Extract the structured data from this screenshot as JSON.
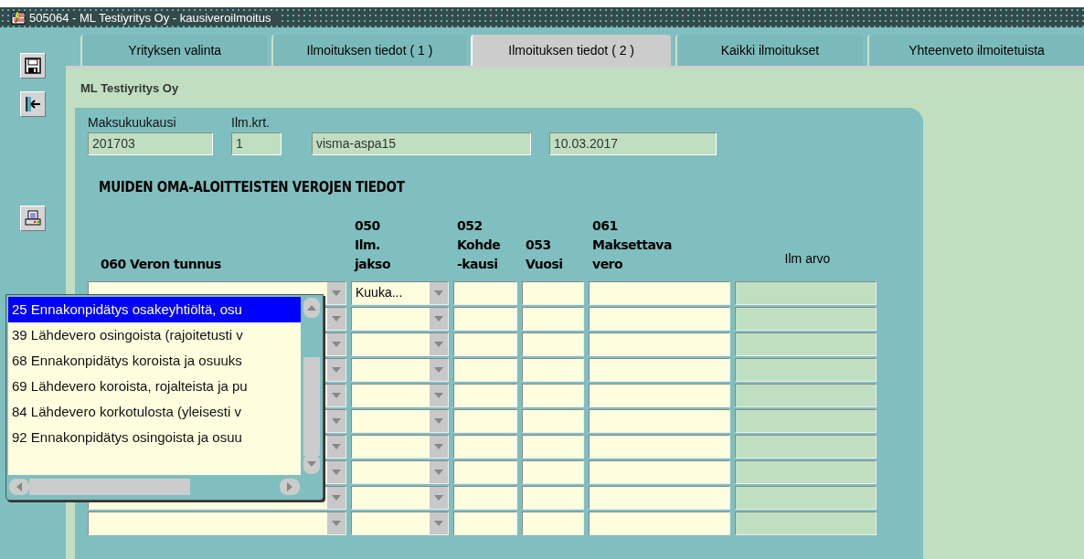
{
  "window": {
    "title": "505064 - ML Testiyritys Oy - kausiveroilmoitus"
  },
  "tabs": [
    {
      "label": "Yrityksen valinta",
      "selected": false
    },
    {
      "label": "Ilmoituksen tiedot ( 1 )",
      "selected": false
    },
    {
      "label": "Ilmoituksen tiedot ( 2 )",
      "selected": true
    },
    {
      "label": "Kaikki ilmoitukset",
      "selected": false
    },
    {
      "label": "Yhteenveto ilmoitetuista",
      "selected": false
    }
  ],
  "company": "ML Testiyritys Oy",
  "header_fields": [
    {
      "label": "Maksukuukausi",
      "value": "201703"
    },
    {
      "label": "Ilm.krt.",
      "value": "1"
    },
    {
      "value": "visma-aspa15"
    },
    {
      "value": "10.03.2017"
    }
  ],
  "section_title": "MUIDEN OMA-ALOITTEISTEN VEROJEN TIEDOT",
  "table": {
    "columns": [
      {
        "kind": "combo",
        "lines": [
          "060 Veron tunnus"
        ]
      },
      {
        "kind": "combo",
        "lines": [
          "050",
          "Ilm.",
          "jakso"
        ]
      },
      {
        "kind": "field",
        "lines": [
          "052",
          "Kohde",
          "-kausi"
        ]
      },
      {
        "kind": "field",
        "lines": [
          "053",
          "Vuosi"
        ]
      },
      {
        "kind": "field",
        "lines": [
          "061",
          "Maksettava",
          "vero"
        ]
      },
      {
        "kind": "readonly",
        "lines": [
          "Ilm arvo"
        ]
      }
    ],
    "rows": [
      {
        "jakso": "Kuuka..."
      },
      {},
      {},
      {},
      {},
      {},
      {},
      {},
      {},
      {}
    ]
  },
  "dropdown": {
    "items": [
      {
        "label": "25 Ennakonpidätys osakeyhtiöltä, osu",
        "selected": true
      },
      {
        "label": "39 Lähdevero osingoista (rajoitetusti v",
        "selected": false
      },
      {
        "label": "68 Ennakonpidätys koroista ja osuuks",
        "selected": false
      },
      {
        "label": "69 Lähdevero koroista, rojalteista ja pu",
        "selected": false
      },
      {
        "label": "84 Lähdevero korkotulosta (yleisesti v",
        "selected": false
      },
      {
        "label": "92 Ennakonpidätys osingoista ja osuu",
        "selected": false
      }
    ]
  }
}
